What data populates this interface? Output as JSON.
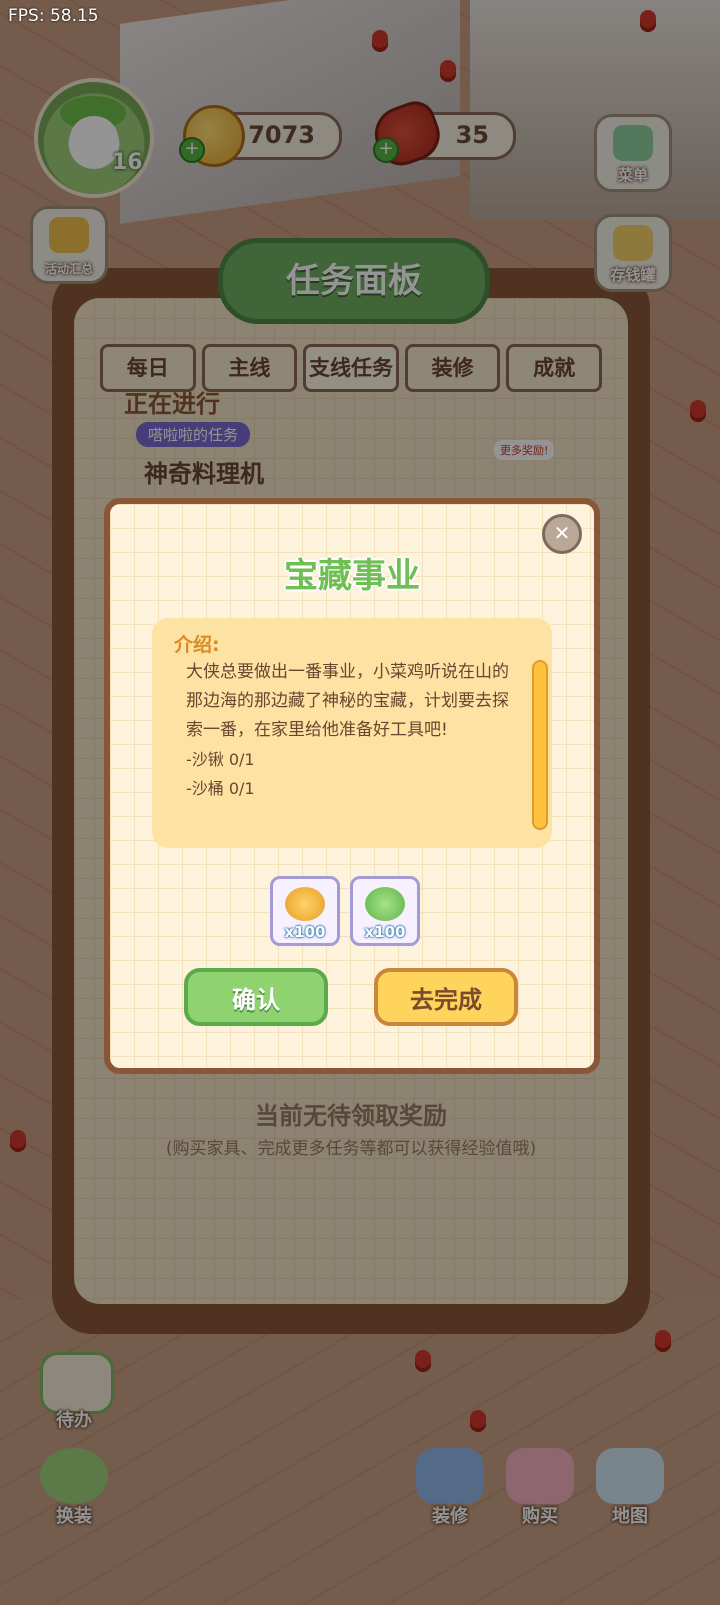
{
  "fps": "FPS: 58.15",
  "player": {
    "level": "16"
  },
  "resources": {
    "coins": "7073",
    "meat": "35"
  },
  "side_menu": {
    "menu_label": "菜单",
    "events_label": "活动汇总",
    "piggy_label": "存钱罐"
  },
  "task_panel": {
    "title": "任务面板",
    "tabs": [
      "每日",
      "主线",
      "支线任务",
      "装修",
      "成就"
    ],
    "active_tab": "支线任务",
    "section": "正在进行",
    "task_tag": "嗒啦啦的任务",
    "task_name": "神奇料理机",
    "more_reward": "更多奖励!",
    "no_reward": "当前无待领取奖励",
    "hint": "(购买家具、完成更多任务等都可以获得经验值哦)"
  },
  "modal": {
    "title": "宝藏事业",
    "intro_label": "介绍:",
    "description": "大侠总要做出一番事业，小菜鸡听说在山的那边海的那边藏了神秘的宝藏，计划要去探索一番，在家里给他准备好工具吧!",
    "requirements": [
      "-沙锹 0/1",
      "-沙桶 0/1"
    ],
    "rewards": [
      {
        "icon": "gold-coin-pile-icon",
        "qty": "x100"
      },
      {
        "icon": "green-exp-icon",
        "qty": "x100"
      }
    ],
    "confirm_label": "确认",
    "complete_label": "去完成"
  },
  "bottom_bar": {
    "todo": "待办",
    "outfit": "换装",
    "decorate": "装修",
    "buy": "购买",
    "map": "地图"
  }
}
